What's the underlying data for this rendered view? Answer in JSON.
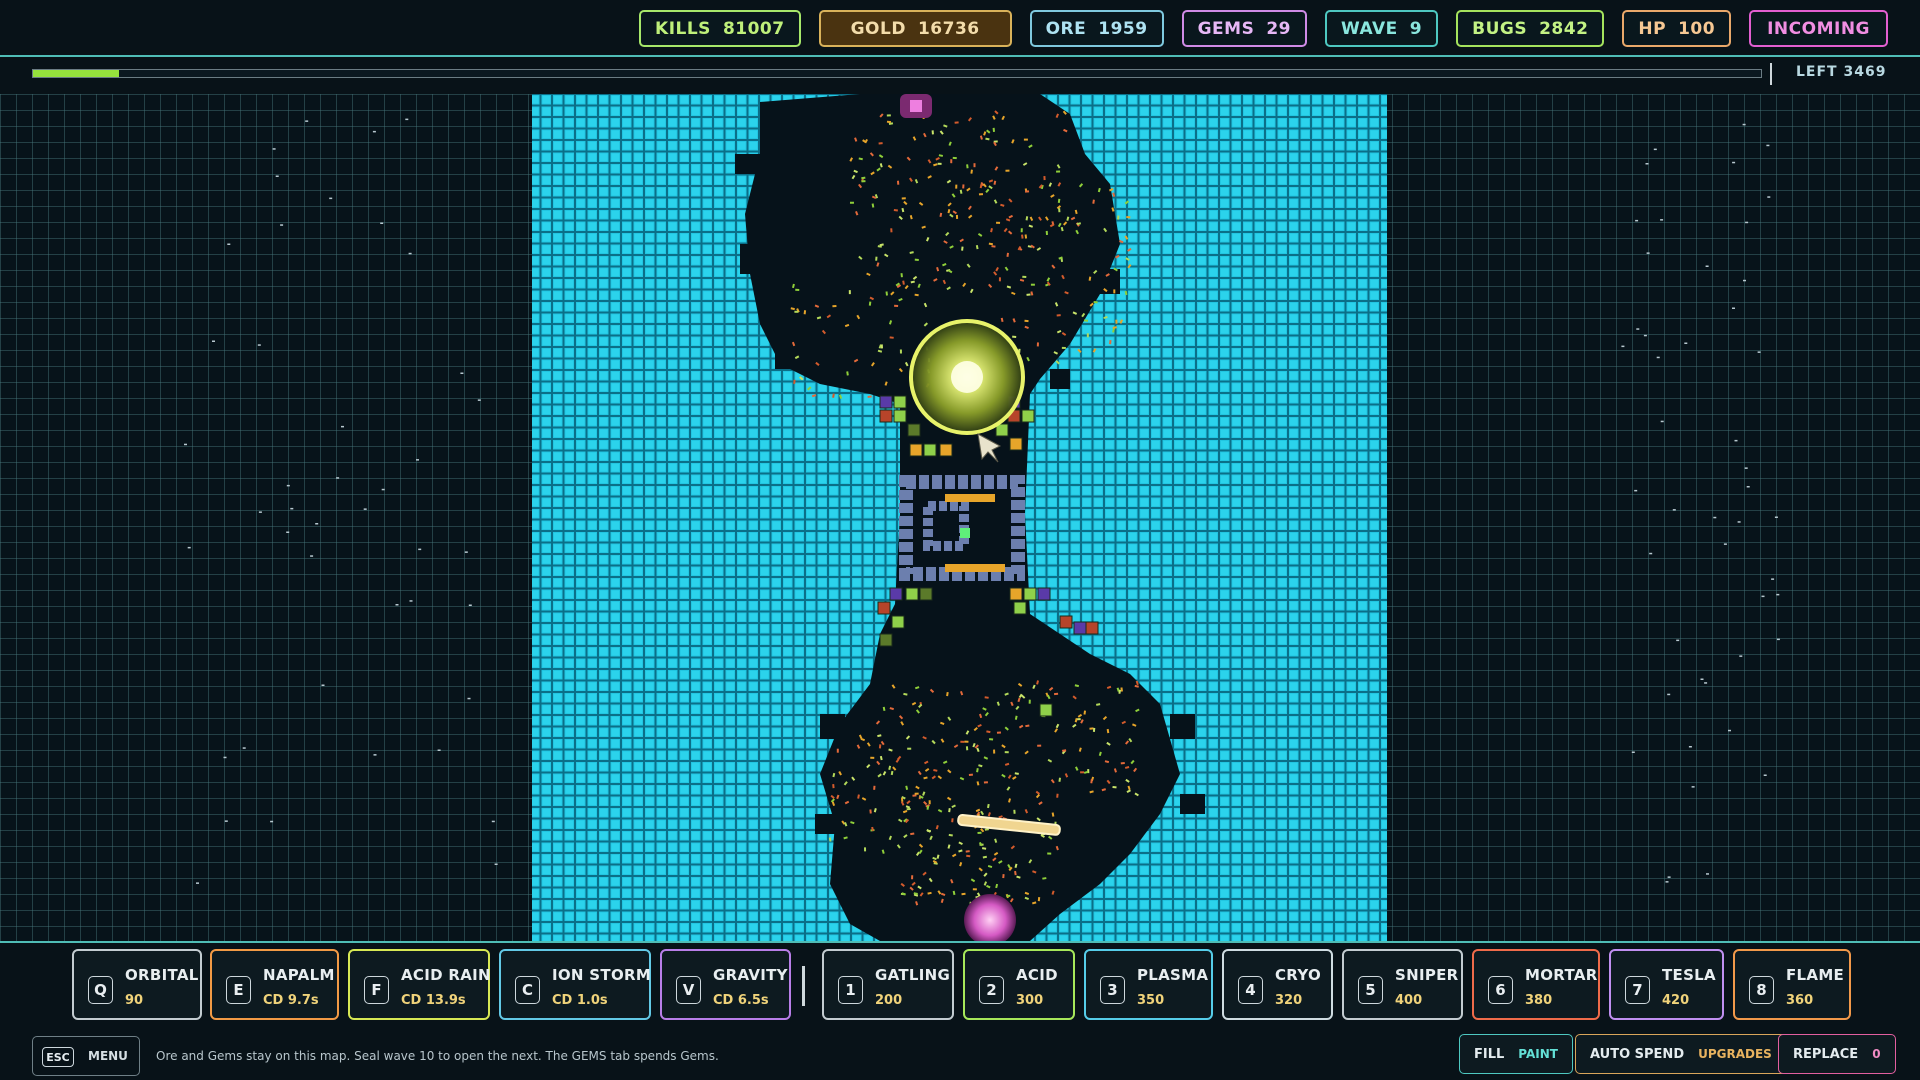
{
  "stats": [
    {
      "label": "KILLS",
      "value": "81007"
    },
    {
      "label": "GOLD",
      "value": "16736"
    },
    {
      "label": "ORE",
      "value": "1959"
    },
    {
      "label": "GEMS",
      "value": "29"
    },
    {
      "label": "WAVE",
      "value": "9"
    },
    {
      "label": "BUGS",
      "value": "2842"
    },
    {
      "label": "HP",
      "value": "100"
    }
  ],
  "incoming": "INCOMING",
  "wave_progress": 0.05,
  "left_counter": "LEFT 3469",
  "abilities": [
    {
      "key": "Q",
      "name": "ORBITAL",
      "value": "90",
      "color": "#c3ccd1"
    },
    {
      "key": "E",
      "name": "NAPALM",
      "value": "CD 9.7s",
      "color": "#f29a45"
    },
    {
      "key": "F",
      "name": "ACID RAIN",
      "value": "CD 13.9s",
      "color": "#d7e854"
    },
    {
      "key": "C",
      "name": "ION STORM",
      "value": "CD 1.0s",
      "color": "#63c9e6"
    },
    {
      "key": "V",
      "name": "GRAVITY",
      "value": "CD 6.5s",
      "color": "#b87ee8"
    }
  ],
  "turrets": [
    {
      "key": "1",
      "name": "GATLING",
      "value": "200",
      "color": "#c3ccd1"
    },
    {
      "key": "2",
      "name": "ACID",
      "value": "300",
      "color": "#a7e85a"
    },
    {
      "key": "3",
      "name": "PLASMA",
      "value": "350",
      "color": "#56cde9"
    },
    {
      "key": "4",
      "name": "CRYO",
      "value": "320",
      "color": "#cfdce1"
    },
    {
      "key": "5",
      "name": "SNIPER",
      "value": "400",
      "color": "#c3ccd1"
    },
    {
      "key": "6",
      "name": "MORTAR",
      "value": "380",
      "color": "#ef6b4a"
    },
    {
      "key": "7",
      "name": "TESLA",
      "value": "420",
      "color": "#c08ff0"
    },
    {
      "key": "8",
      "name": "FLAME",
      "value": "360",
      "color": "#f2994a"
    }
  ],
  "menu": {
    "key": "ESC",
    "label": "MENU"
  },
  "hint": "Ore and Gems stay on this map. Seal wave 10 to open the next. The GEMS tab spends Gems.",
  "buttons": {
    "fill": {
      "label": "FILL",
      "sub": "PAINT"
    },
    "auto": {
      "label": "AUTO SPEND",
      "sub": "UPGRADES"
    },
    "replace": {
      "label": "REPLACE",
      "sub": "0"
    }
  },
  "icons": [
    "orbital-beam-icon",
    "player-ship-icon",
    "spawn-portal-icon"
  ]
}
